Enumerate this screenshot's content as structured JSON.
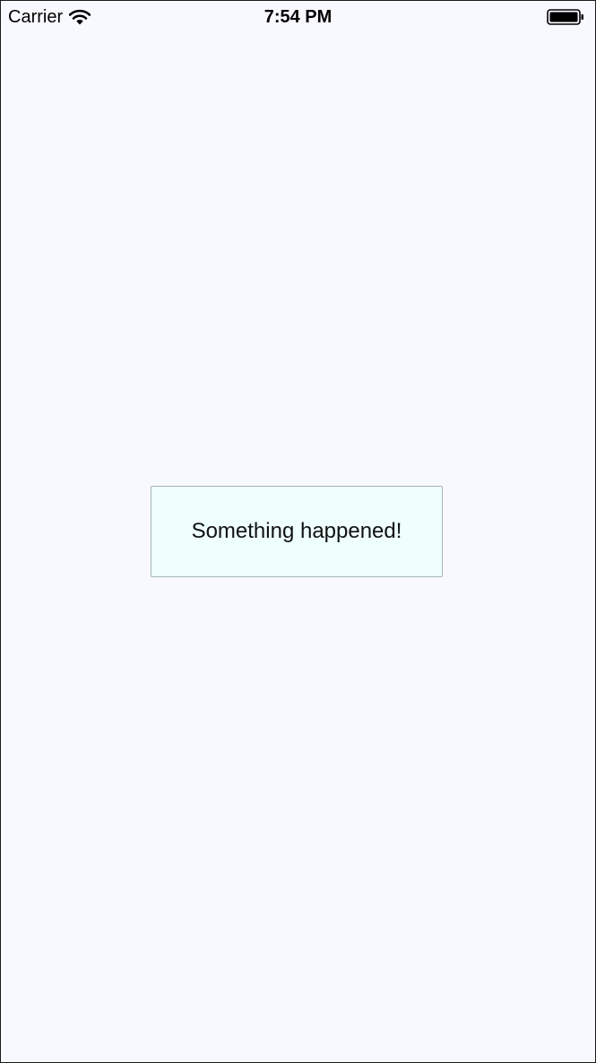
{
  "status_bar": {
    "carrier": "Carrier",
    "time": "7:54 PM",
    "wifi_icon": "wifi-icon",
    "battery_icon": "battery-icon"
  },
  "toast": {
    "message": "Something happened!"
  },
  "colors": {
    "background": "#f8f9fe",
    "toast_background": "#eefffe",
    "toast_border": "#a6b4b4"
  }
}
